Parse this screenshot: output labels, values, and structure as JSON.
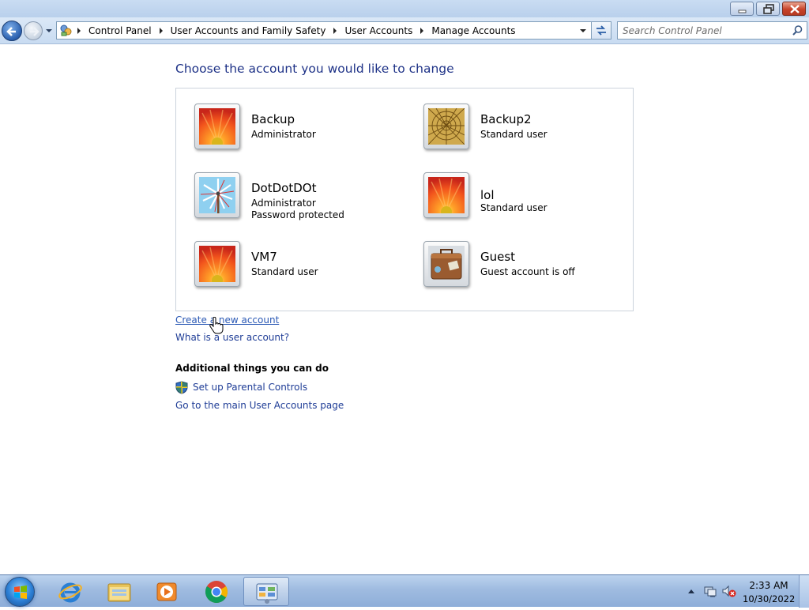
{
  "window": {
    "breadcrumbs": [
      "Control Panel",
      "User Accounts and Family Safety",
      "User Accounts",
      "Manage Accounts"
    ],
    "search_placeholder": "Search Control Panel"
  },
  "main": {
    "title": "Choose the account you would like to change",
    "accounts": [
      {
        "name": "Backup",
        "details": [
          "Administrator"
        ],
        "picture": "orange-flower"
      },
      {
        "name": "Backup2",
        "details": [
          "Standard user"
        ],
        "picture": "gold-shell"
      },
      {
        "name": "DotDotDOt",
        "details": [
          "Administrator",
          "Password protected"
        ],
        "picture": "pinwheel"
      },
      {
        "name": "lol",
        "details": [
          "Standard user"
        ],
        "picture": "orange-flower"
      },
      {
        "name": "VM7",
        "details": [
          "Standard user"
        ],
        "picture": "orange-flower"
      },
      {
        "name": "Guest",
        "details": [
          "Guest account is off"
        ],
        "picture": "suitcase"
      }
    ],
    "links": {
      "create": "Create a new account",
      "what": "What is a user account?"
    },
    "additional": {
      "heading": "Additional things you can do",
      "parental": "Set up Parental Controls",
      "main_page": "Go to the main User Accounts page"
    }
  },
  "taskbar": {
    "apps": [
      "internet-explorer-icon",
      "windows-explorer-icon",
      "media-player-icon",
      "chrome-icon",
      "control-panel-icon"
    ],
    "time": "2:33 AM",
    "date": "10/30/2022"
  },
  "colors": {
    "link": "#1e3c96",
    "title": "#1e3287",
    "taskbar": "#9fbbe0"
  }
}
